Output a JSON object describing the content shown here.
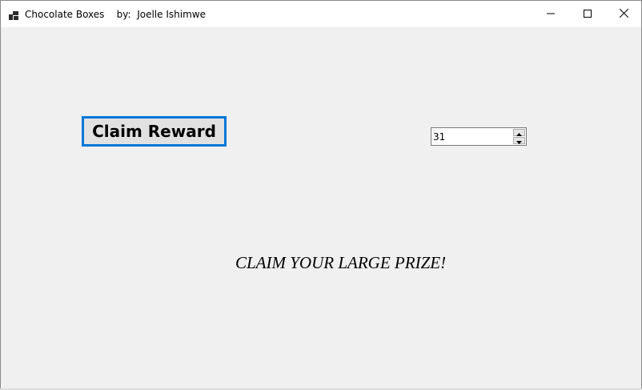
{
  "window": {
    "title": "Chocolate Boxes    by:  Joelle Ishimwe"
  },
  "controls": {
    "claim_button_label": "Claim Reward",
    "counter_value": "31"
  },
  "message": {
    "text": "CLAIM YOUR LARGE PRIZE!"
  },
  "icons": {
    "app": "app-icon",
    "minimize": "minimize-icon",
    "maximize": "maximize-icon",
    "close": "close-icon",
    "spin_up": "chevron-up-icon",
    "spin_down": "chevron-down-icon"
  },
  "colors": {
    "background": "#f0f0f0",
    "titlebar": "#ffffff",
    "focus_border": "#0078d7",
    "button_face": "#e1e1e1"
  }
}
